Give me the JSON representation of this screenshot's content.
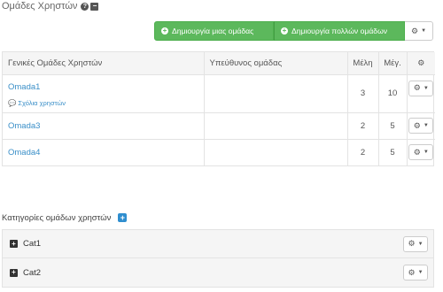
{
  "page": {
    "title": "Ομάδες Χρηστών",
    "help_icon": "question-circle-icon",
    "collapse_icon": "minus-square-icon"
  },
  "toolbar": {
    "create_one_label": "Δημιουργία μιας ομάδας",
    "create_many_label": "Δημιουργία πολλών ομάδων",
    "settings_icon": "cogs-icon"
  },
  "groups_table": {
    "columns": {
      "name": "Γενικές Ομάδες Χρηστών",
      "owner": "Υπεύθυνος ομάδας",
      "members": "Μέλη",
      "max": "Μέγ."
    },
    "rows": [
      {
        "name": "Omada1",
        "owner": "",
        "members": "3",
        "max": "10",
        "comments_label": "Σχόλια χρηστών"
      },
      {
        "name": "Omada3",
        "owner": "",
        "members": "2",
        "max": "5"
      },
      {
        "name": "Omada4",
        "owner": "",
        "members": "2",
        "max": "5"
      }
    ]
  },
  "categories": {
    "title": "Κατηγορίες ομάδων χρηστών",
    "items": [
      {
        "name": "Cat1"
      },
      {
        "name": "Cat2"
      }
    ]
  },
  "colors": {
    "primary_green": "#5cb85c",
    "link_blue": "#3a8fc8",
    "header_gray": "#f5f5f5"
  }
}
